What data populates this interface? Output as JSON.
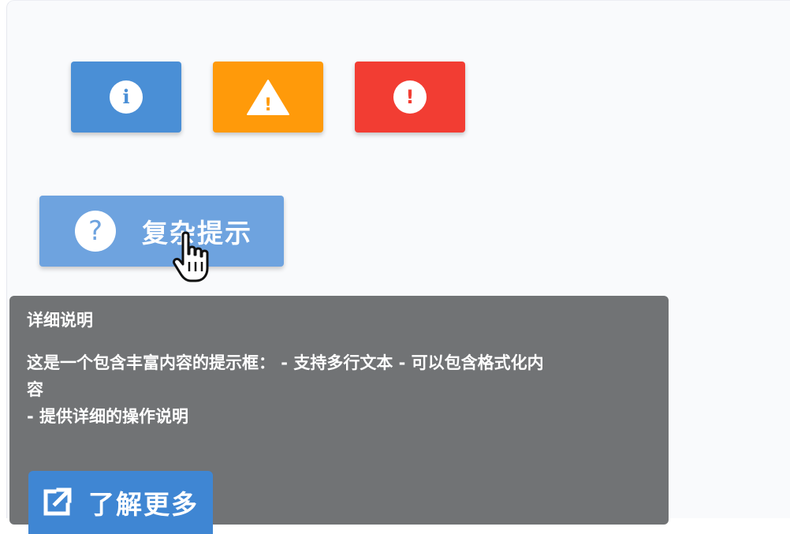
{
  "colors": {
    "info": "#4a8fd6",
    "warning": "#ff9a0a",
    "error": "#f23d33",
    "help_button": "#6ea3df",
    "tooltip_bg": "#717375",
    "learn_button": "#3f86d3"
  },
  "icons": {
    "info": "i",
    "warning": "!",
    "error": "!",
    "help": "?"
  },
  "help_button": {
    "label": "复杂提示"
  },
  "tooltip": {
    "title": "详细说明",
    "body_line1": "这是一个包含丰富内容的提示框： - 支持多行文本 - 可以包含格式化内",
    "body_line2": "容",
    "body_line3": "- 提供详细的操作说明",
    "link_label": "了解更多"
  }
}
